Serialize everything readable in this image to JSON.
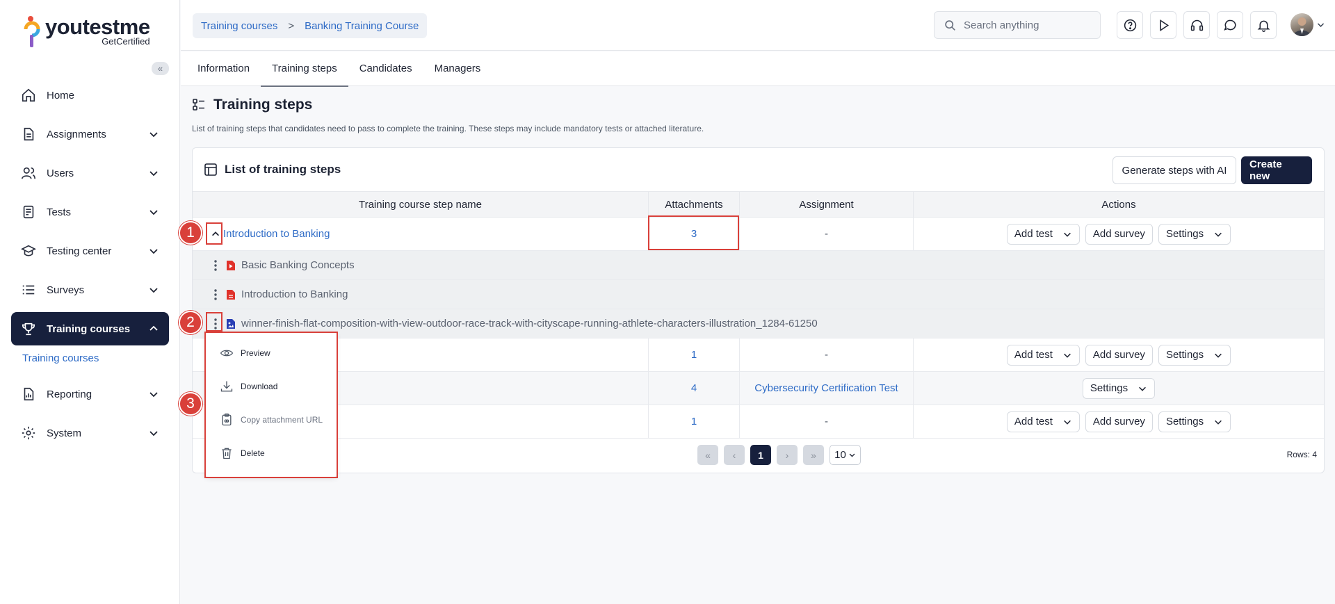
{
  "brand": {
    "name_you": "youtest",
    "name_me": "me",
    "tagline": "GetCertified"
  },
  "sidebar": {
    "collapse_glyph": "«",
    "items": [
      {
        "label": "Home",
        "icon": "home-icon"
      },
      {
        "label": "Assignments",
        "icon": "document-icon"
      },
      {
        "label": "Users",
        "icon": "users-icon"
      },
      {
        "label": "Tests",
        "icon": "test-icon"
      },
      {
        "label": "Testing center",
        "icon": "graduation-cap-icon"
      },
      {
        "label": "Surveys",
        "icon": "list-icon"
      },
      {
        "label": "Training courses",
        "icon": "trophy-icon",
        "active": true
      },
      {
        "label": "Reporting",
        "icon": "report-icon"
      },
      {
        "label": "System",
        "icon": "gear-icon"
      }
    ],
    "sub_item": "Training courses"
  },
  "header": {
    "breadcrumb": [
      "Training courses",
      "Banking Training Course"
    ],
    "breadcrumb_sep": ">",
    "search_placeholder": "Search anything"
  },
  "tabs": [
    "Information",
    "Training steps",
    "Candidates",
    "Managers"
  ],
  "section": {
    "title": "Training steps",
    "description": "List of training steps that candidates need to pass to complete the training. These steps may include mandatory tests or attached literature."
  },
  "card": {
    "title": "List of training steps",
    "generate_btn": "Generate steps with AI",
    "create_btn": "Create new"
  },
  "table": {
    "columns": [
      "Training course step name",
      "Attachments",
      "Assignment",
      "Actions"
    ],
    "first_row": {
      "name": "Introduction to Banking",
      "attachments": "3",
      "assignment": "-"
    },
    "attachments": [
      {
        "name": "Basic Banking Concepts"
      },
      {
        "name": "Introduction to Banking"
      },
      {
        "name": "winner-finish-flat-composition-with-view-outdoor-race-track-with-cityscape-running-athlete-characters-illustration_1284-61250"
      }
    ],
    "rows": [
      {
        "attachments": "1",
        "assignment": "-"
      },
      {
        "attachments": "4",
        "assignment": "Cybersecurity Certification Test"
      },
      {
        "attachments": "1",
        "assignment": "-"
      }
    ],
    "action_add_test": "Add test",
    "action_add_survey": "Add survey",
    "action_settings": "Settings"
  },
  "pagination": {
    "first": "«",
    "prev": "‹",
    "current": "1",
    "next": "›",
    "last": "»",
    "page_size": "10",
    "rows_label": "Rows: 4"
  },
  "context_menu": {
    "items": [
      {
        "label": "Preview",
        "icon": "eye-icon"
      },
      {
        "label": "Download",
        "icon": "download-icon"
      },
      {
        "label": "Copy attachment URL",
        "icon": "clipboard-icon",
        "disabled": true
      },
      {
        "label": "Delete",
        "icon": "trash-icon"
      }
    ]
  },
  "annotations": [
    "1",
    "2",
    "3"
  ],
  "colors": {
    "accent": "#17203d",
    "link": "#2e6bc6",
    "annotation": "#d9403a"
  }
}
